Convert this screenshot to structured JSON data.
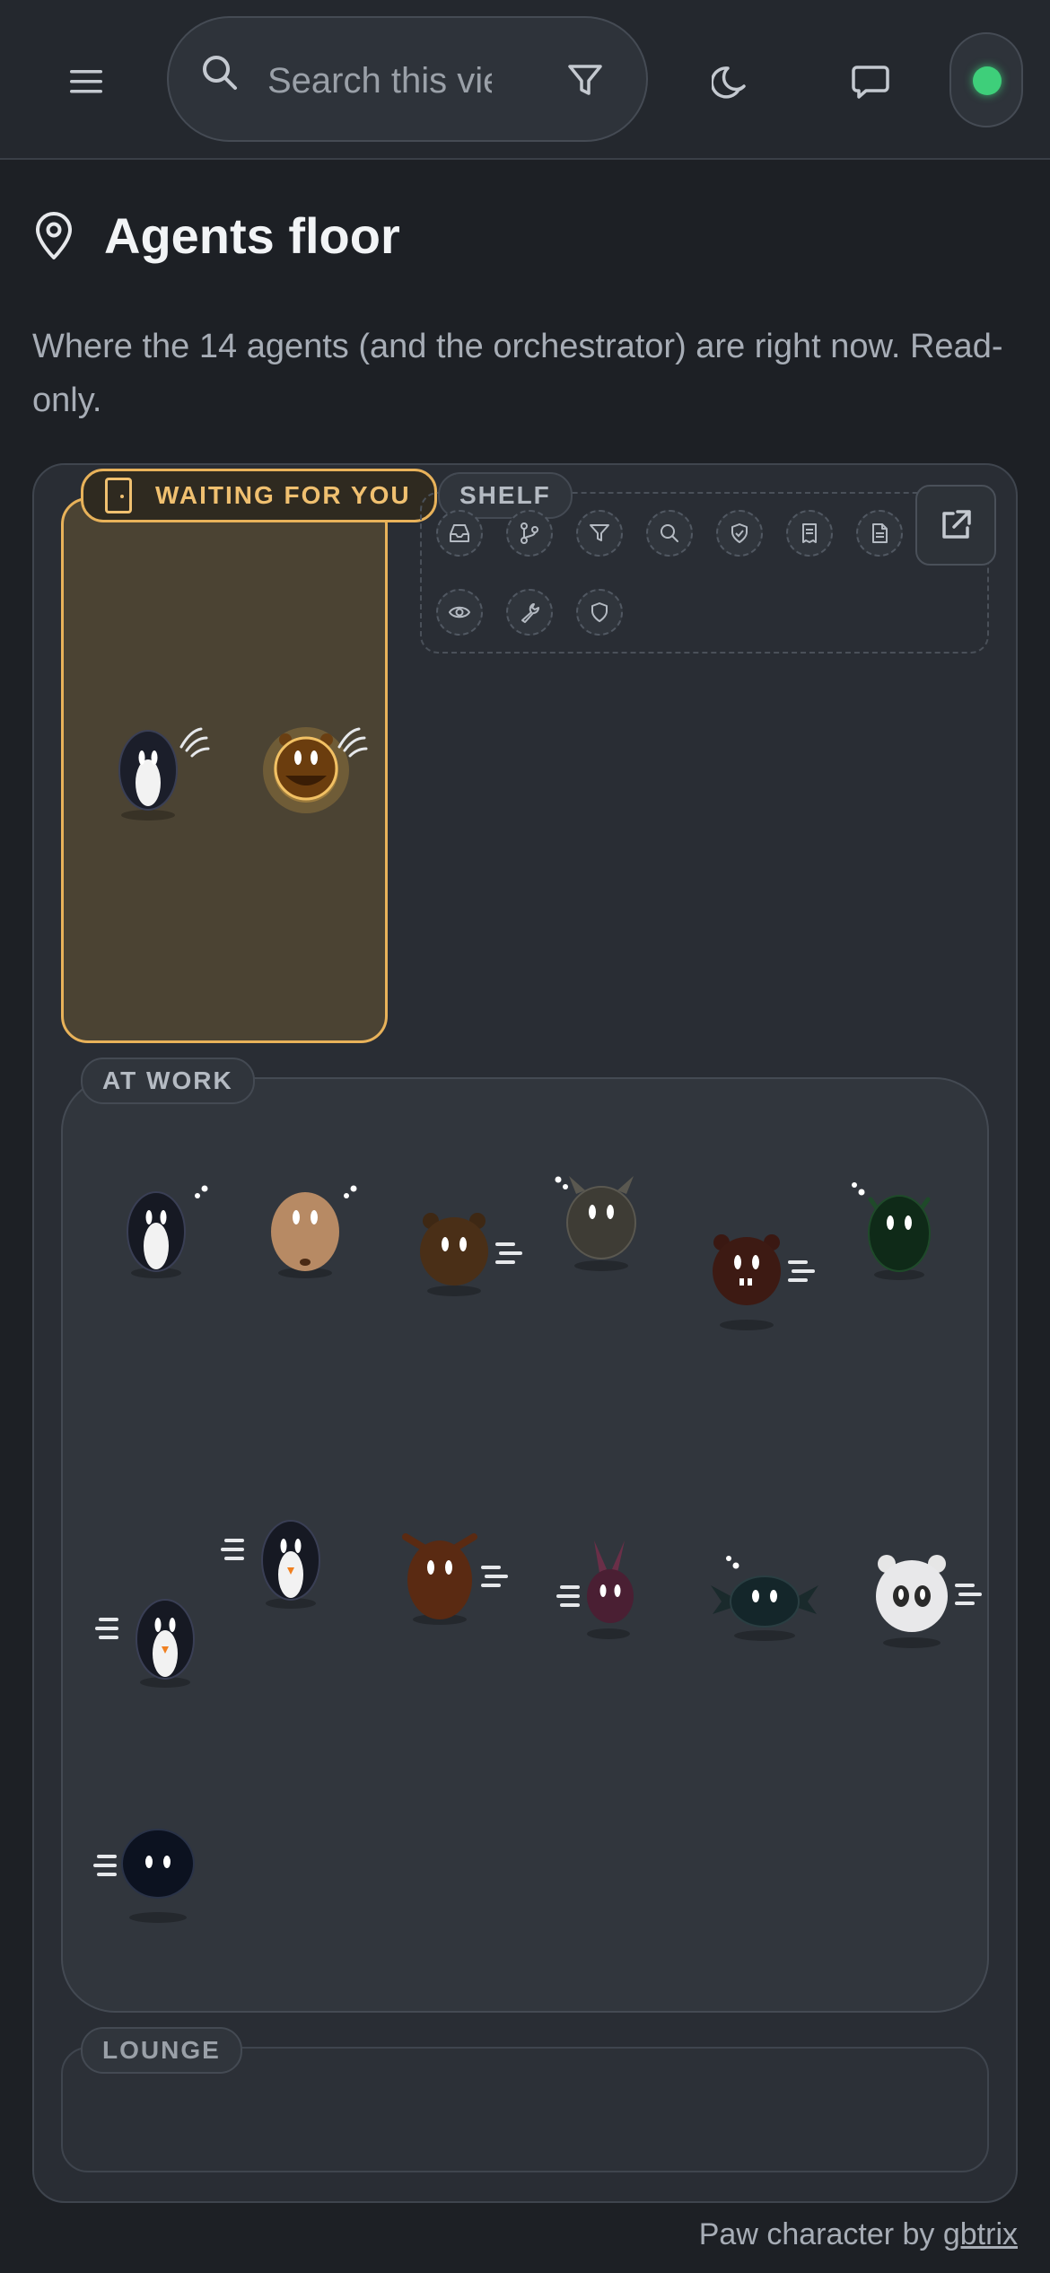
{
  "topbar": {
    "search_placeholder": "Search this view",
    "status_color": "#3ecf7a"
  },
  "page": {
    "title": "Agents floor",
    "description": "Where the 14 agents (and the orchestrator) are right now. Read-only."
  },
  "zones": {
    "waiting_label": "WAITING FOR YOU",
    "shelf_label": "SHELF",
    "work_label": "AT WORK",
    "lounge_label": "LOUNGE"
  },
  "shelf_tools": [
    "inbox-icon",
    "git-branch-icon",
    "filter-icon",
    "search-icon",
    "shield-check-icon",
    "receipt-icon",
    "document-icon",
    "eye-icon",
    "wrench-icon",
    "shield-icon"
  ],
  "agents": {
    "waiting": [
      {
        "kind": "penguin",
        "status": "waving"
      },
      {
        "kind": "bear-glow",
        "status": "waving"
      }
    ],
    "at_work": [
      {
        "kind": "penguin",
        "status": "thinking"
      },
      {
        "kind": "beaver",
        "status": "thinking"
      },
      {
        "kind": "bear",
        "status": "moving"
      },
      {
        "kind": "goat",
        "status": "thinking"
      },
      {
        "kind": "bear-dark",
        "status": "moving"
      },
      {
        "kind": "frog",
        "status": "thinking"
      },
      {
        "kind": "penguin",
        "status": "moving"
      },
      {
        "kind": "penguin",
        "status": "moving"
      },
      {
        "kind": "deer",
        "status": "moving"
      },
      {
        "kind": "bunny",
        "status": "moving"
      },
      {
        "kind": "bat",
        "status": "thinking"
      },
      {
        "kind": "panda",
        "status": "moving"
      },
      {
        "kind": "blob",
        "status": "moving"
      }
    ]
  },
  "footer": {
    "credit_text": "Paw character by",
    "credit_link": "gbtrix"
  },
  "colors": {
    "accent_waiting": "#e8b25a",
    "background": "#1d2025"
  }
}
